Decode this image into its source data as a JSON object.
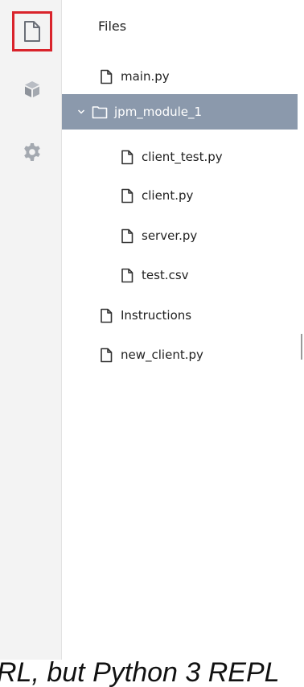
{
  "panel": {
    "title": "Files"
  },
  "activity_bar": {
    "items": [
      {
        "icon": "file-icon",
        "active": true
      },
      {
        "icon": "package-icon",
        "active": false
      },
      {
        "icon": "gear-icon",
        "active": false
      }
    ]
  },
  "tree": {
    "items": [
      {
        "label": "main.py",
        "type": "file",
        "level": 0
      },
      {
        "label": "jpm_module_1",
        "type": "folder",
        "level": 0,
        "expanded": true,
        "selected": true
      },
      {
        "label": "client_test.py",
        "type": "file",
        "level": 1
      },
      {
        "label": "client.py",
        "type": "file",
        "level": 1
      },
      {
        "label": "server.py",
        "type": "file",
        "level": 1
      },
      {
        "label": "test.csv",
        "type": "file",
        "level": 1
      },
      {
        "label": "Instructions",
        "type": "file",
        "level": 0
      },
      {
        "label": "new_client.py",
        "type": "file",
        "level": 0
      }
    ]
  },
  "footer_text": "RL, but Python 3 REPL",
  "colors": {
    "active_border": "#d9232b",
    "selected_bg": "#8b99ac",
    "activity_bg": "#f3f3f3"
  }
}
